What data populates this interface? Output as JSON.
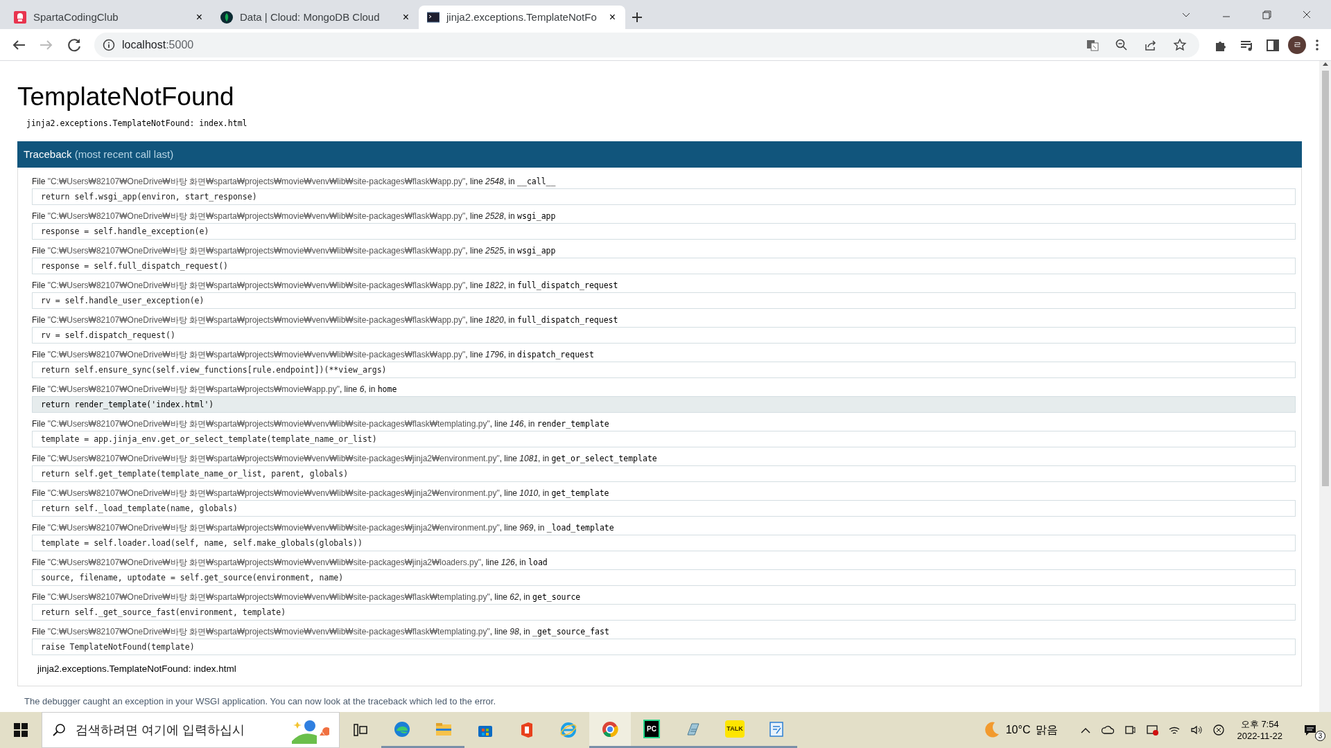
{
  "browser": {
    "tabs": [
      {
        "title": "SpartaCodingClub",
        "kind": "sparta",
        "close": "×",
        "selected": false
      },
      {
        "title": "Data | Cloud: MongoDB Cloud",
        "kind": "mongo",
        "close": "×",
        "selected": false
      },
      {
        "title": "jinja2.exceptions.TemplateNotFo",
        "kind": "terminal",
        "close": "×",
        "selected": true
      }
    ],
    "url_host": "localhost",
    "url_port": ":5000",
    "profile_initial": "ㄹ"
  },
  "page": {
    "title": "TemplateNotFound",
    "exception": "jinja2.exceptions.TemplateNotFound: index.html",
    "traceback_title": "Traceback",
    "traceback_note": "(most recent call last)",
    "frames": [
      {
        "file_label": "File",
        "path": "\"C:₩Users₩82107₩OneDrive₩바탕 화면₩sparta₩projects₩movie₩venv₩lib₩site-packages₩flask₩app.py\"",
        "line_label": ", line",
        "line": "2548",
        "in_label": ", in",
        "function": "__call__",
        "code": "return self.wsgi_app(environ, start_response)",
        "highlighted": false
      },
      {
        "file_label": "File",
        "path": "\"C:₩Users₩82107₩OneDrive₩바탕 화면₩sparta₩projects₩movie₩venv₩lib₩site-packages₩flask₩app.py\"",
        "line_label": ", line",
        "line": "2528",
        "in_label": ", in",
        "function": "wsgi_app",
        "code": "response = self.handle_exception(e)",
        "highlighted": false
      },
      {
        "file_label": "File",
        "path": "\"C:₩Users₩82107₩OneDrive₩바탕 화면₩sparta₩projects₩movie₩venv₩lib₩site-packages₩flask₩app.py\"",
        "line_label": ", line",
        "line": "2525",
        "in_label": ", in",
        "function": "wsgi_app",
        "code": "response = self.full_dispatch_request()",
        "highlighted": false
      },
      {
        "file_label": "File",
        "path": "\"C:₩Users₩82107₩OneDrive₩바탕 화면₩sparta₩projects₩movie₩venv₩lib₩site-packages₩flask₩app.py\"",
        "line_label": ", line",
        "line": "1822",
        "in_label": ", in",
        "function": "full_dispatch_request",
        "code": "rv = self.handle_user_exception(e)",
        "highlighted": false
      },
      {
        "file_label": "File",
        "path": "\"C:₩Users₩82107₩OneDrive₩바탕 화면₩sparta₩projects₩movie₩venv₩lib₩site-packages₩flask₩app.py\"",
        "line_label": ", line",
        "line": "1820",
        "in_label": ", in",
        "function": "full_dispatch_request",
        "code": "rv = self.dispatch_request()",
        "highlighted": false
      },
      {
        "file_label": "File",
        "path": "\"C:₩Users₩82107₩OneDrive₩바탕 화면₩sparta₩projects₩movie₩venv₩lib₩site-packages₩flask₩app.py\"",
        "line_label": ", line",
        "line": "1796",
        "in_label": ", in",
        "function": "dispatch_request",
        "code": "return self.ensure_sync(self.view_functions[rule.endpoint])(**view_args)",
        "highlighted": false
      },
      {
        "file_label": "File",
        "path": "\"C:₩Users₩82107₩OneDrive₩바탕 화면₩sparta₩projects₩movie₩app.py\"",
        "line_label": ", line",
        "line": "6",
        "in_label": ", in",
        "function": "home",
        "code": "return render_template('index.html')",
        "highlighted": true
      },
      {
        "file_label": "File",
        "path": "\"C:₩Users₩82107₩OneDrive₩바탕 화면₩sparta₩projects₩movie₩venv₩lib₩site-packages₩flask₩templating.py\"",
        "line_label": ", line",
        "line": "146",
        "in_label": ", in",
        "function": "render_template",
        "code": "template = app.jinja_env.get_or_select_template(template_name_or_list)",
        "highlighted": false
      },
      {
        "file_label": "File",
        "path": "\"C:₩Users₩82107₩OneDrive₩바탕 화면₩sparta₩projects₩movie₩venv₩lib₩site-packages₩jinja2₩environment.py\"",
        "line_label": ", line",
        "line": "1081",
        "in_label": ", in",
        "function": "get_or_select_template",
        "code": "return self.get_template(template_name_or_list, parent, globals)",
        "highlighted": false
      },
      {
        "file_label": "File",
        "path": "\"C:₩Users₩82107₩OneDrive₩바탕 화면₩sparta₩projects₩movie₩venv₩lib₩site-packages₩jinja2₩environment.py\"",
        "line_label": ", line",
        "line": "1010",
        "in_label": ", in",
        "function": "get_template",
        "code": "return self._load_template(name, globals)",
        "highlighted": false
      },
      {
        "file_label": "File",
        "path": "\"C:₩Users₩82107₩OneDrive₩바탕 화면₩sparta₩projects₩movie₩venv₩lib₩site-packages₩jinja2₩environment.py\"",
        "line_label": ", line",
        "line": "969",
        "in_label": ", in",
        "function": "_load_template",
        "code": "template = self.loader.load(self, name, self.make_globals(globals))",
        "highlighted": false
      },
      {
        "file_label": "File",
        "path": "\"C:₩Users₩82107₩OneDrive₩바탕 화면₩sparta₩projects₩movie₩venv₩lib₩site-packages₩jinja2₩loaders.py\"",
        "line_label": ", line",
        "line": "126",
        "in_label": ", in",
        "function": "load",
        "code": "source, filename, uptodate = self.get_source(environment, name)",
        "highlighted": false
      },
      {
        "file_label": "File",
        "path": "\"C:₩Users₩82107₩OneDrive₩바탕 화면₩sparta₩projects₩movie₩venv₩lib₩site-packages₩flask₩templating.py\"",
        "line_label": ", line",
        "line": "62",
        "in_label": ", in",
        "function": "get_source",
        "code": "return self._get_source_fast(environment, template)",
        "highlighted": false
      },
      {
        "file_label": "File",
        "path": "\"C:₩Users₩82107₩OneDrive₩바탕 화면₩sparta₩projects₩movie₩venv₩lib₩site-packages₩flask₩templating.py\"",
        "line_label": ", line",
        "line": "98",
        "in_label": ", in",
        "function": "_get_source_fast",
        "code": "raise TemplateNotFound(template)",
        "highlighted": false
      }
    ],
    "final_exception": "jinja2.exceptions.TemplateNotFound: index.html",
    "debugger_note": "The debugger caught an exception in your WSGI application. You can now look at the traceback which led to the error."
  },
  "taskbar": {
    "search": {
      "placeholder": "검색하려면 여기에 입력하십시"
    },
    "apps": [
      {
        "kind": "taskview",
        "running": false,
        "selected": false
      },
      {
        "kind": "edge",
        "running": true,
        "selected": false
      },
      {
        "kind": "folder",
        "running": true,
        "selected": false
      },
      {
        "kind": "store",
        "running": false,
        "selected": false
      },
      {
        "kind": "office",
        "running": false,
        "selected": false
      },
      {
        "kind": "ie",
        "running": false,
        "selected": false
      },
      {
        "kind": "chrome",
        "running": true,
        "selected": true
      },
      {
        "kind": "pycharm",
        "label": "PC",
        "running": true,
        "selected": false
      },
      {
        "kind": "notepad",
        "running": true,
        "selected": false
      },
      {
        "kind": "talk",
        "label": "TALK",
        "running": true,
        "selected": false
      },
      {
        "kind": "hangul",
        "running": true,
        "selected": false
      }
    ],
    "temperature": "10°C",
    "weather": "맑음",
    "time": "오후 7:54",
    "date": "2022-11-22",
    "notifications": "3"
  }
}
